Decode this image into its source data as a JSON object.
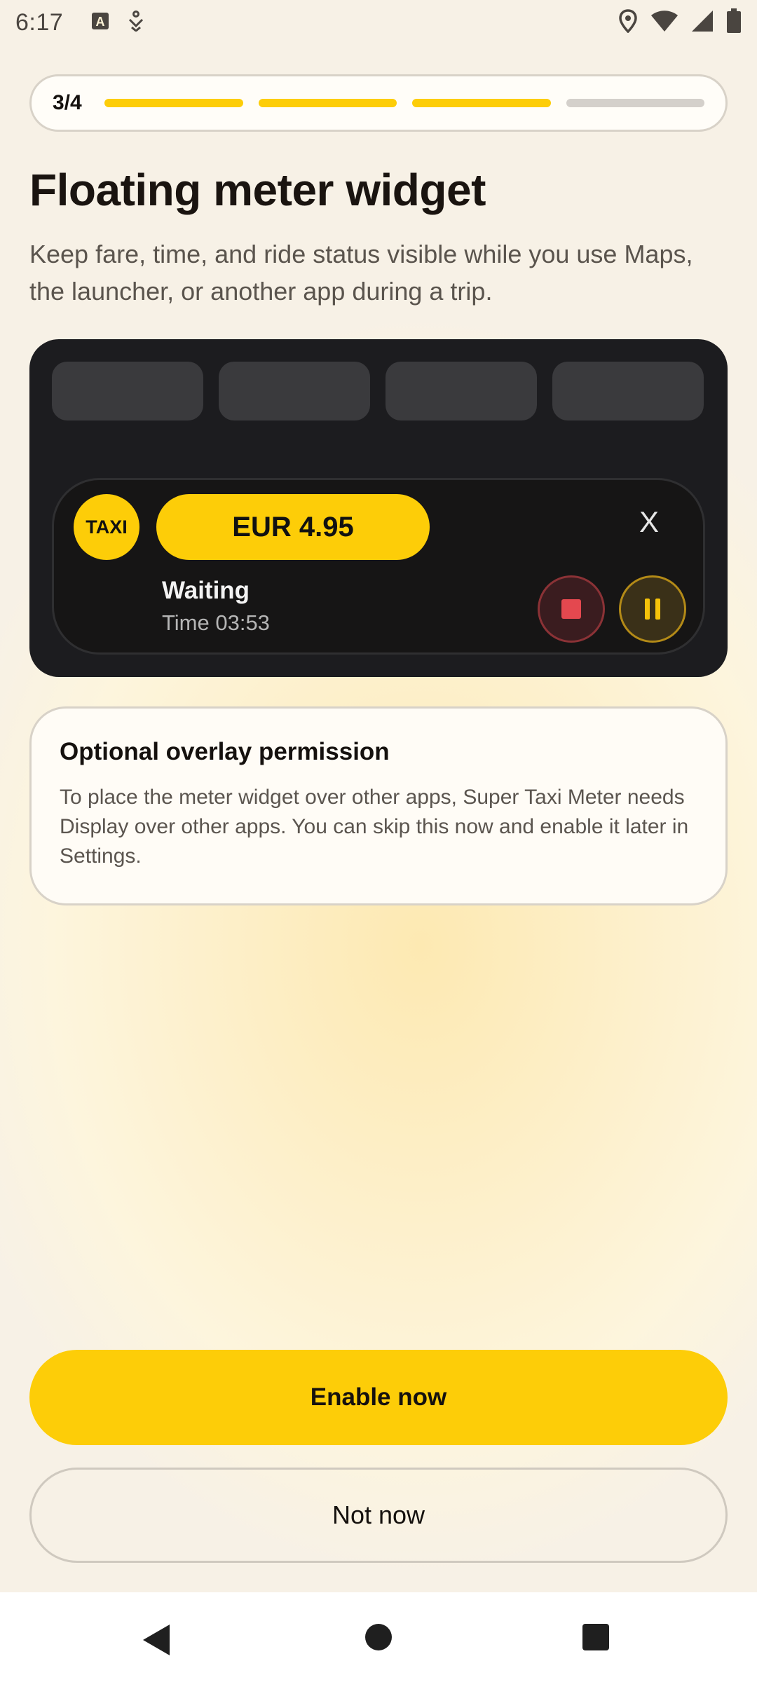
{
  "status_bar": {
    "time": "6:17",
    "left_icons": [
      "keyboard-a-icon",
      "accessibility-icon"
    ],
    "right_icons": [
      "location-icon",
      "wifi-icon",
      "cell-signal-icon",
      "battery-icon"
    ]
  },
  "progress": {
    "label": "3/4",
    "current_step": 3,
    "total_steps": 4,
    "accent_color": "#fdcd08"
  },
  "title": "Floating meter widget",
  "subtitle": "Keep fare, time, and ride status visible while you use Maps, the launcher, or another app during a trip.",
  "preview": {
    "placeholder_tiles": 4,
    "widget": {
      "badge": "TAXI",
      "fare": "EUR 4.95",
      "close_label": "X",
      "status": "Waiting",
      "time": "Time 03:53"
    }
  },
  "permission_card": {
    "title": "Optional overlay permission",
    "body": "To place the meter widget over other apps, Super Taxi Meter needs Display over other apps. You can skip this now and enable it later in Settings."
  },
  "buttons": {
    "primary": "Enable now",
    "secondary": "Not now"
  }
}
